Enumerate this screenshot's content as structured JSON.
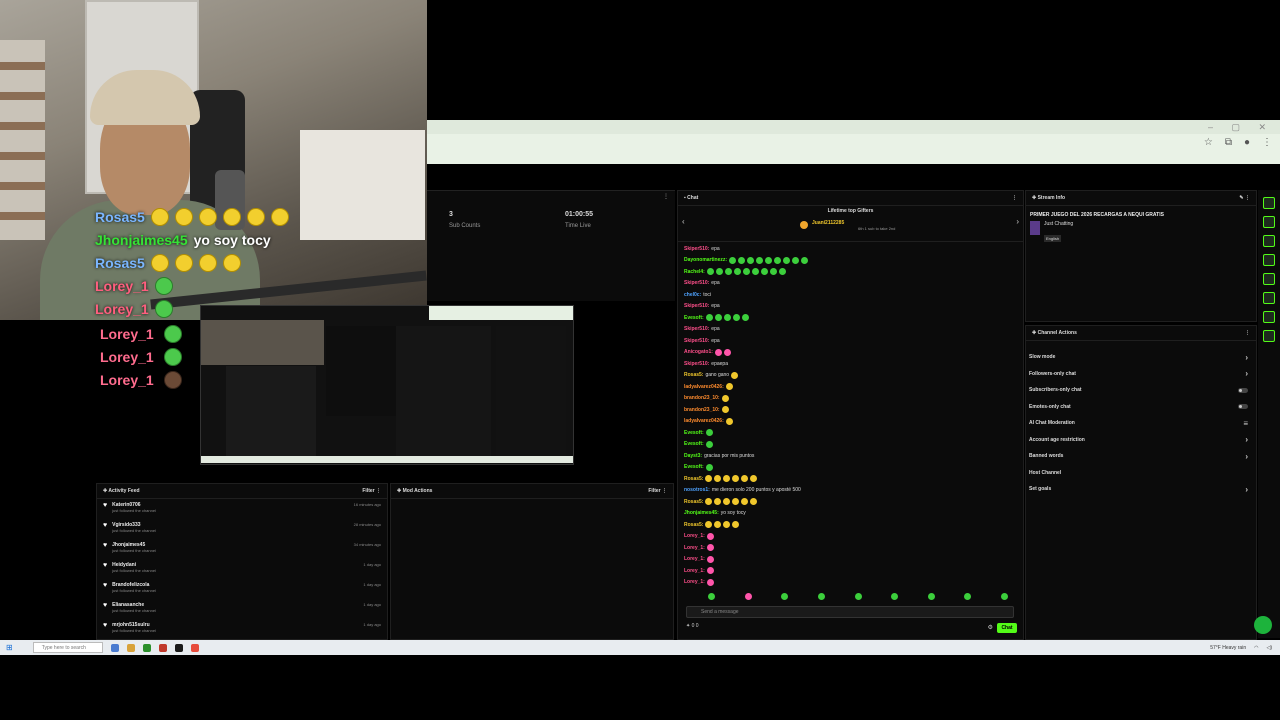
{
  "overlay_chat": [
    {
      "user": "Rosas5",
      "message": "",
      "color": "blue",
      "emotes": 6
    },
    {
      "user": "Jhonjaimes45",
      "message": "yo soy tocy",
      "color": "green",
      "emotes": 0
    },
    {
      "user": "Rosas5",
      "message": "",
      "color": "blue",
      "emotes": 4
    },
    {
      "user": "Lorey_1",
      "message": "",
      "color": "pink",
      "emotes": 1
    },
    {
      "user": "Lorey_1",
      "message": "",
      "color": "pink",
      "emotes": 1
    }
  ],
  "lorey_rows": [
    "Lorey_1",
    "Lorey_1",
    "Lorey_1"
  ],
  "stats": {
    "sub_count": "3",
    "sub_label": "Sub Counts",
    "time_live": "01:00:55",
    "time_label": "Time Live"
  },
  "activity_feed": {
    "title": "Activity Feed",
    "filter": "Filter",
    "items": [
      {
        "name": "Katerin0706",
        "action": "just followed the channel",
        "time": "16 minutes ago"
      },
      {
        "name": "Vgirsido333",
        "action": "just followed the channel",
        "time": "28 minutes ago"
      },
      {
        "name": "Jhonjaimes45",
        "action": "just followed the channel",
        "time": "34 minutes ago"
      },
      {
        "name": "Heidydani",
        "action": "just followed the channel",
        "time": "1 day ago"
      },
      {
        "name": "Brandofelizcola",
        "action": "just followed the channel",
        "time": "1 day ago"
      },
      {
        "name": "Elianasanche",
        "action": "just followed the channel",
        "time": "1 day ago"
      },
      {
        "name": "mrjohn515sulru",
        "action": "just followed the channel",
        "time": "1 day ago"
      }
    ]
  },
  "mod_actions": {
    "title": "Mod Actions",
    "filter": "Filter"
  },
  "chat": {
    "title": "Chat",
    "gifters_title": "Lifetime top Gifters",
    "top_gifter": "Juani2112285",
    "gift_note": "6th 1 sub to take 2nd",
    "messages": [
      {
        "user": "Skiper510",
        "text": "epa",
        "color": "#ff4f8b",
        "emotes": 0
      },
      {
        "user": "Dayonomartinezz",
        "text": "",
        "color": "#53fc18",
        "emotes": 9
      },
      {
        "user": "Rachel4",
        "text": "",
        "color": "#53fc18",
        "emotes": 9
      },
      {
        "user": "Skiper510",
        "text": "epa",
        "color": "#ff4f8b",
        "emotes": 0
      },
      {
        "user": "chel0c",
        "text": "toci",
        "color": "#4fa3ff",
        "emotes": 0
      },
      {
        "user": "Skiper510",
        "text": "epa",
        "color": "#ff4f8b",
        "emotes": 0
      },
      {
        "user": "Evesoft",
        "text": "",
        "color": "#53fc18",
        "emotes": 5
      },
      {
        "user": "Skiper510",
        "text": "epa",
        "color": "#ff4f8b",
        "emotes": 0
      },
      {
        "user": "Skiper510",
        "text": "epa",
        "color": "#ff4f8b",
        "emotes": 0
      },
      {
        "user": "Anicogato1",
        "text": "",
        "color": "#ff4f8b",
        "emotes": 2
      },
      {
        "user": "Skiper510",
        "text": "epaepa",
        "color": "#ff4f8b",
        "emotes": 0
      },
      {
        "user": "Rosas5",
        "text": "gano gano",
        "color": "#f0c72c",
        "emotes": 1
      },
      {
        "user": "ladyalvarez0426",
        "text": "",
        "color": "#ff8c2e",
        "emotes": 1
      },
      {
        "user": "brandon23_10",
        "text": "",
        "color": "#ff8c2e",
        "emotes": 1
      },
      {
        "user": "brandon23_10",
        "text": "",
        "color": "#ff8c2e",
        "emotes": 1
      },
      {
        "user": "ladyalvarez0426",
        "text": "",
        "color": "#ff8c2e",
        "emotes": 1
      },
      {
        "user": "Evesoft",
        "text": "",
        "color": "#53fc18",
        "emotes": 1
      },
      {
        "user": "Evesoft",
        "text": "",
        "color": "#53fc18",
        "emotes": 1
      },
      {
        "user": "Dayst3",
        "text": "gracias por mis puntos",
        "color": "#53fc18",
        "emotes": 0
      },
      {
        "user": "Evesoft",
        "text": "",
        "color": "#53fc18",
        "emotes": 1
      },
      {
        "user": "Rosas5",
        "text": "",
        "color": "#f0c72c",
        "emotes": 6
      },
      {
        "user": "nosotros1",
        "text": "me dieron solo 200 puntos y aposté 500",
        "color": "#4fa3ff",
        "emotes": 0
      },
      {
        "user": "Rosas5",
        "text": "",
        "color": "#f0c72c",
        "emotes": 6
      },
      {
        "user": "Jhonjaimes45",
        "text": "yo soy tocy",
        "color": "#53fc18",
        "emotes": 0
      },
      {
        "user": "Rosas5",
        "text": "",
        "color": "#f0c72c",
        "emotes": 4
      },
      {
        "user": "Lorey_1",
        "text": "",
        "color": "#ff4f8b",
        "emotes": 1
      },
      {
        "user": "Lorey_1",
        "text": "",
        "color": "#ff4f8b",
        "emotes": 1
      },
      {
        "user": "Lorey_1",
        "text": "",
        "color": "#ff4f8b",
        "emotes": 1
      },
      {
        "user": "Lorey_1",
        "text": "",
        "color": "#ff4f8b",
        "emotes": 1
      },
      {
        "user": "Lorey_1",
        "text": "",
        "color": "#ff4f8b",
        "emotes": 1
      }
    ],
    "input_placeholder": "Send a message",
    "foot_left": "0 0",
    "send_label": "Chat"
  },
  "stream_info": {
    "title": "Stream Info",
    "stream_title": "PRIMER JUEGO DEL 2026 RECARGAS A NEQUI GRATIS",
    "category": "Just Chatting",
    "language": "English"
  },
  "channel_actions": {
    "title": "Channel Actions",
    "items": [
      {
        "label": "Slow mode",
        "kind": "chevron"
      },
      {
        "label": "Followers-only chat",
        "kind": "chevron"
      },
      {
        "label": "Subscribers-only chat",
        "kind": "toggle"
      },
      {
        "label": "Emotes-only chat",
        "kind": "toggle"
      },
      {
        "label": "AI Chat Moderation",
        "kind": "icon"
      },
      {
        "label": "Account age restriction",
        "kind": "chevron"
      },
      {
        "label": "Banned words",
        "kind": "chevron"
      },
      {
        "label": "Host Channel",
        "kind": "none"
      },
      {
        "label": "Set goals",
        "kind": "chevron"
      }
    ]
  },
  "taskbar": {
    "search_placeholder": "Type here to search",
    "weather": "57°F Heavy rain"
  },
  "colors": {
    "accent": "#53fc18",
    "panel": "#0b0b0b"
  }
}
